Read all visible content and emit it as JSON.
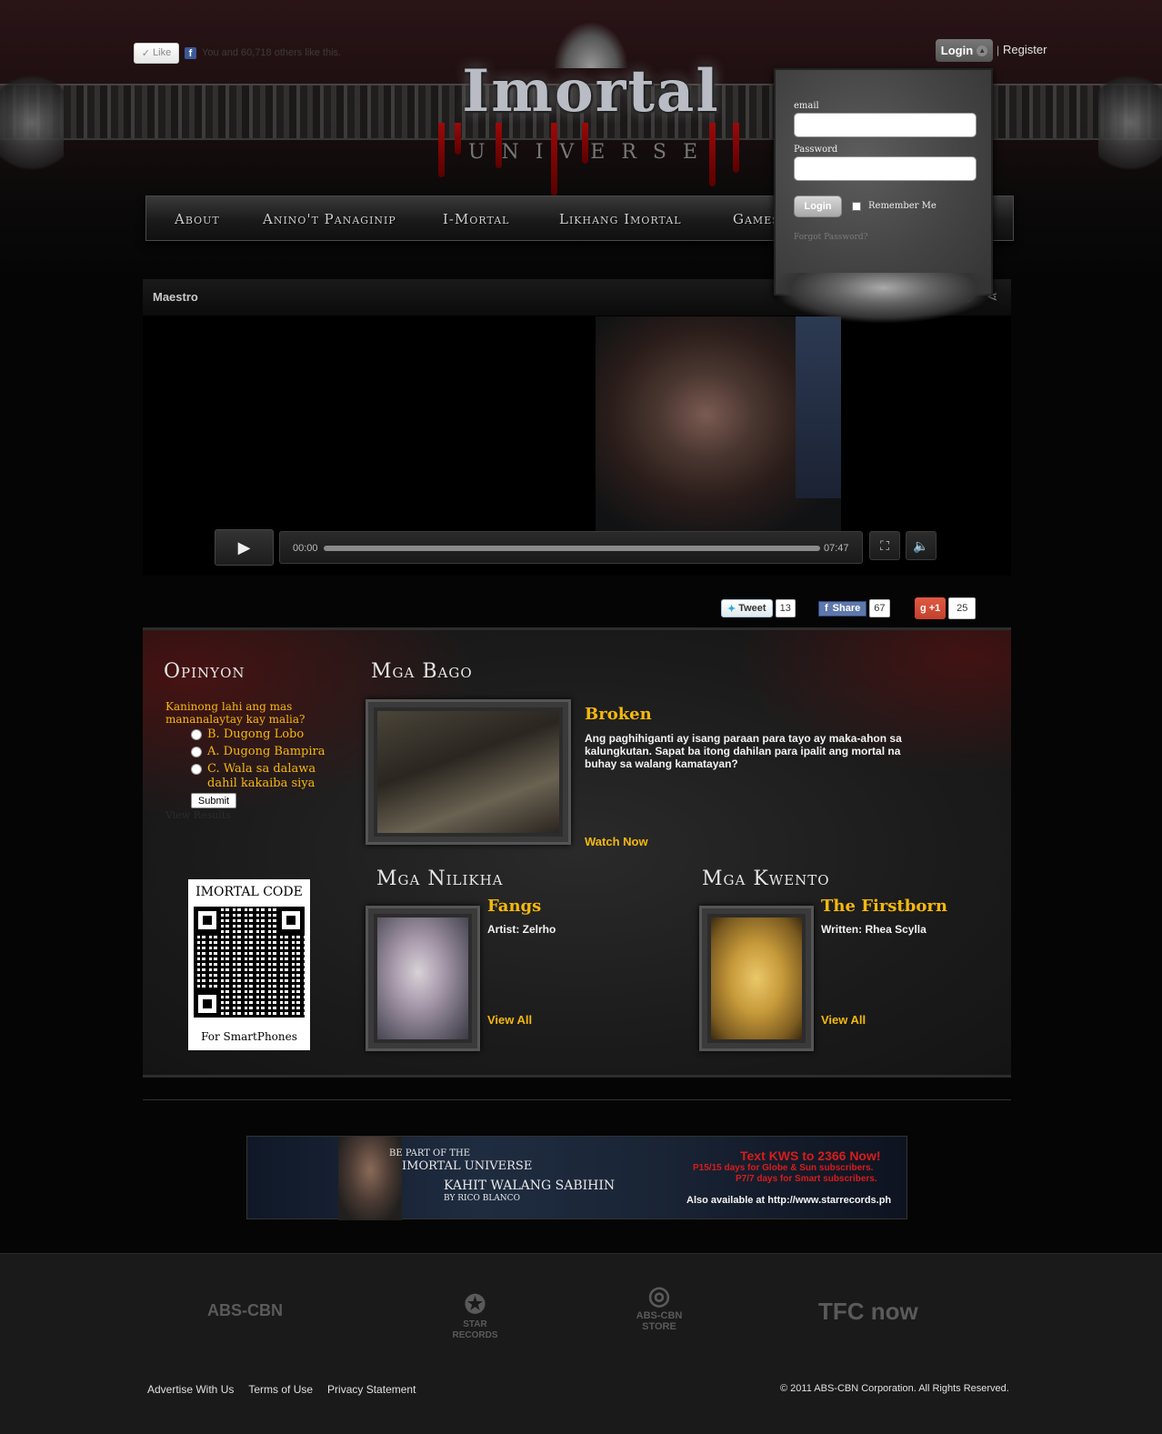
{
  "header": {
    "like_label": "Like",
    "like_text": "You and 60,718 others like this.",
    "logo_title": "Imortal",
    "logo_subtitle": "UNIVERSE",
    "login_label": "Login",
    "separator": "|",
    "register_label": "Register"
  },
  "login_panel": {
    "email_label": "email",
    "password_label": "Password",
    "submit_label": "Login",
    "remember_label": "Remember Me",
    "forgot_label": "Forgot Password?"
  },
  "nav": {
    "items": [
      {
        "label": "About"
      },
      {
        "label": "Anino't Panaginip"
      },
      {
        "label": "I-Mortal"
      },
      {
        "label": "Likhang Imortal"
      },
      {
        "label": "Games"
      }
    ]
  },
  "video": {
    "title": "Maestro",
    "time_current": "00:00",
    "time_total": "07:47",
    "progress": 0
  },
  "social": {
    "tweet_label": "Tweet",
    "tweet_count": "13",
    "share_label": "Share",
    "share_count": "67",
    "gplus_label": "+1",
    "gplus_count": "25"
  },
  "opinyon": {
    "heading": "Opinyon",
    "question": "Kaninong lahi ang mas mananalaytay kay malia?",
    "options": [
      {
        "label": "B. Dugong Lobo"
      },
      {
        "label": "A. Dugong Bampira"
      },
      {
        "label": "C. Wala sa dalawa dahil kakaiba siya"
      }
    ],
    "submit_label": "Submit",
    "results_label": "View Results"
  },
  "qr": {
    "title": "IMORTAL CODE",
    "subtitle": "For SmartPhones"
  },
  "mga_bago": {
    "heading": "Mga Bago",
    "title": "Broken",
    "description": "Ang paghihiganti ay isang paraan para tayo ay maka-ahon sa kalungkutan. Sapat ba itong dahilan para ipalit ang mortal na buhay sa walang kamatayan?",
    "link": "Watch Now"
  },
  "mga_nilikha": {
    "heading": "Mga Nilikha",
    "title": "Fangs",
    "meta": "Artist: Zelrho",
    "link": "View All"
  },
  "mga_kwento": {
    "heading": "Mga Kwento",
    "title": "The Firstborn",
    "meta": "Written: Rhea Scylla",
    "link": "View All"
  },
  "banner": {
    "line1": "BE PART OF THE",
    "line2": "IMORTAL UNIVERSE",
    "song": "KAHIT WALANG SABIHIN",
    "artist": "BY RICO BLANCO",
    "cta": "Text KWS to 2366 Now!",
    "price1": "P15/15 days for Globe & Sun subscribers.",
    "price2": "P7/7 days for Smart subscribers.",
    "also": "Also available at http://www.starrecords.ph"
  },
  "footer": {
    "logos": [
      "ABS-CBN",
      "STAR RECORDS",
      "ABS-CBN STORE",
      "TFC now"
    ],
    "links": [
      "Advertise With Us",
      "Terms of Use",
      "Privacy Statement"
    ],
    "copyright": "© 2011 ABS-CBN Corporation. All Rights Reserved."
  },
  "colors": {
    "accent": "#f6b80d",
    "blood": "#9b0a0a"
  }
}
